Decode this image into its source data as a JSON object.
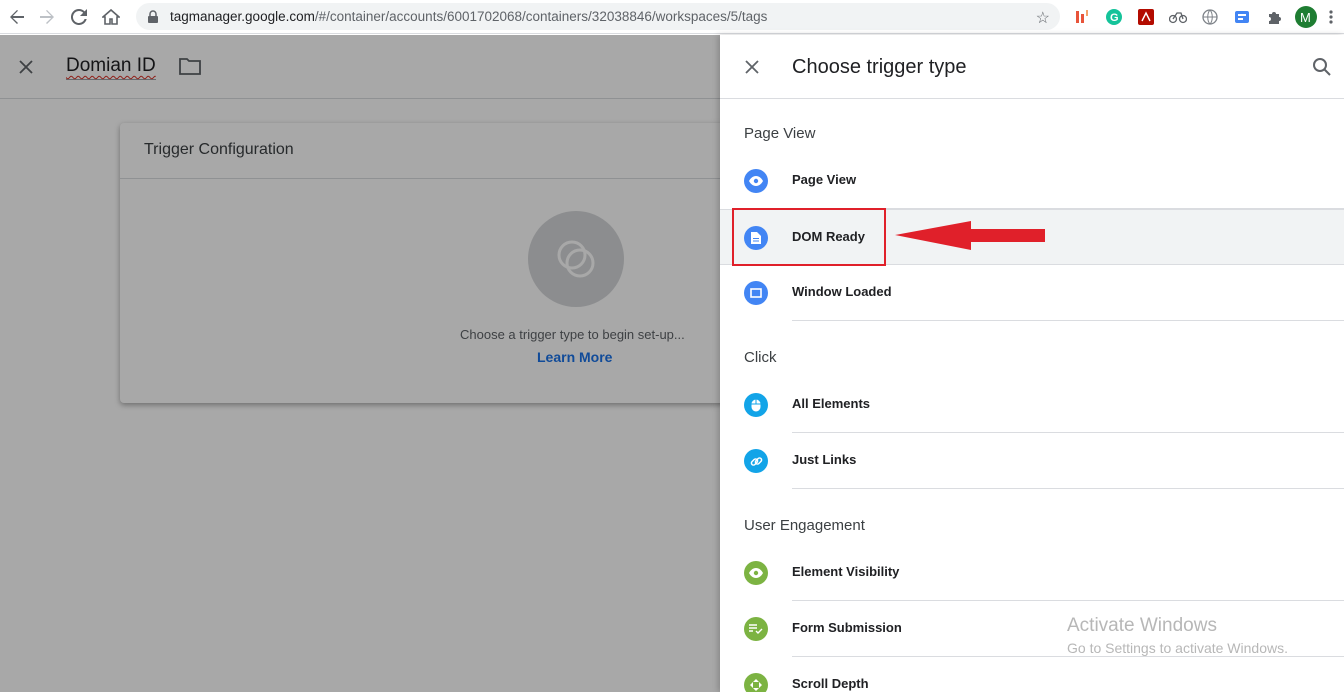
{
  "browser": {
    "url_host": "tagmanager.google.com",
    "url_path": "/#/container/accounts/6001702068/containers/32038846/workspaces/5/tags",
    "profile_initial": "M"
  },
  "editor": {
    "tag_name": "Domian ID",
    "card_title": "Trigger Configuration",
    "hint": "Choose a trigger type to begin set-up...",
    "learn_more": "Learn More"
  },
  "panel": {
    "title": "Choose trigger type",
    "sections": [
      {
        "label": "Page View",
        "items": [
          "Page View",
          "DOM Ready",
          "Window Loaded"
        ]
      },
      {
        "label": "Click",
        "items": [
          "All Elements",
          "Just Links"
        ]
      },
      {
        "label": "User Engagement",
        "items": [
          "Element Visibility",
          "Form Submission",
          "Scroll Depth"
        ]
      }
    ]
  },
  "watermark": {
    "line1": "Activate Windows",
    "line2": "Go to Settings to activate Windows."
  },
  "colors": {
    "page_view": "#4285f4",
    "click": "#12a4e8",
    "engagement": "#7cb342",
    "highlight_box": "#e0202a"
  }
}
